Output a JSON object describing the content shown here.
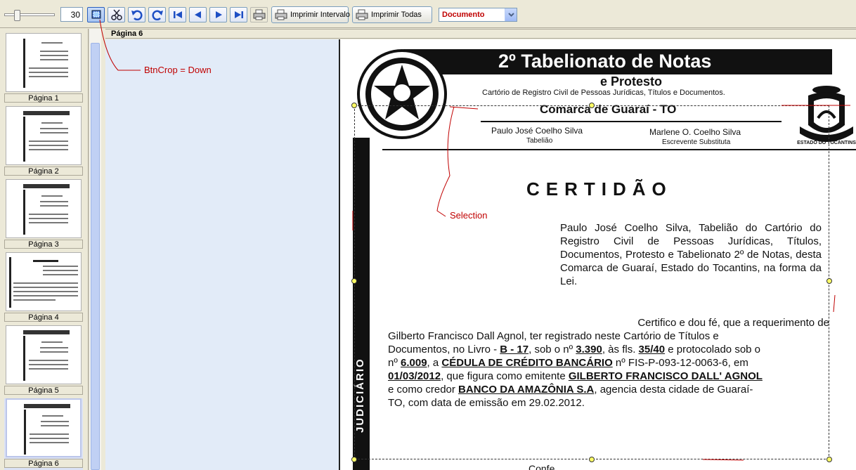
{
  "toolbar": {
    "zoom_value": "30",
    "print_range_label": "Imprimir Intervalo",
    "print_all_label": "Imprimir Todas",
    "view_mode_selected": "Documento"
  },
  "thumbnails": [
    {
      "label": "Página 1"
    },
    {
      "label": "Página 2"
    },
    {
      "label": "Página 3"
    },
    {
      "label": "Página 4"
    },
    {
      "label": "Página 5"
    },
    {
      "label": "Página 6",
      "selected": true
    }
  ],
  "viewer": {
    "page_title": "Página 6"
  },
  "annotations": {
    "btncrop": "BtnCrop = Down",
    "selection": "Selection"
  },
  "document": {
    "office_title": "2º Tabelionato de Notas",
    "office_subtitle": "e Protesto",
    "office_registry": "Cartório de Registro Civil de Pessoas Jurídicas, Títulos e Documentos.",
    "comarca": "Comarca de Guaraí - TO",
    "signer1_name": "Paulo José Coelho Silva",
    "signer1_role": "Tabelião",
    "signer2_name": "Marlene O. Coelho Silva",
    "signer2_role": "Escrevente Substituta",
    "side_band": "JUDICIÁRIO",
    "seal_text": "ESTADO DO TOCANTINS",
    "heading": "CERTIDÃO",
    "intro": "Paulo José Coelho Silva, Tabelião do Cartório do Registro Civil de Pessoas Jurídicas, Títulos, Documentos, Protesto e Tabelionato 2º de Notas, desta Comarca de Guaraí, Estado do Tocantins, na forma da Lei.",
    "body_p1": "Certifico e dou fé, que a requerimento de",
    "body_p2": "Gilberto Francisco Dall Agnol, ter registrado neste Cartório de Títulos e",
    "body_p3a": "Documentos, no Livro - ",
    "livro": "B - 17",
    "body_p3b": ", sob o nº ",
    "numero": "3.390",
    "body_p3c": ", às fls. ",
    "folhas": "35/40",
    "body_p3d": " e protocolado sob o",
    "body_p4a": "nº ",
    "protocolo": "6.009",
    "body_p4b": ", a ",
    "doc_tipo": "CÉDULA DE CRÉDITO BANCÁRIO",
    "body_p4c": " nº FIS-P-093-12-0063-6, em",
    "data_reg": "01/03/2012",
    "body_p5": ", que figura como emitente ",
    "emitente": "GILBERTO FRANCISCO DALL' AGNOL",
    "body_p6a": "e como credor ",
    "credor": "BANCO DA AMAZÔNIA S.A",
    "body_p6b": ", agencia desta cidade de Guaraí-",
    "body_p7": "TO, com data de emissão em 29.02.2012.",
    "footer_partial": "Confe..."
  }
}
